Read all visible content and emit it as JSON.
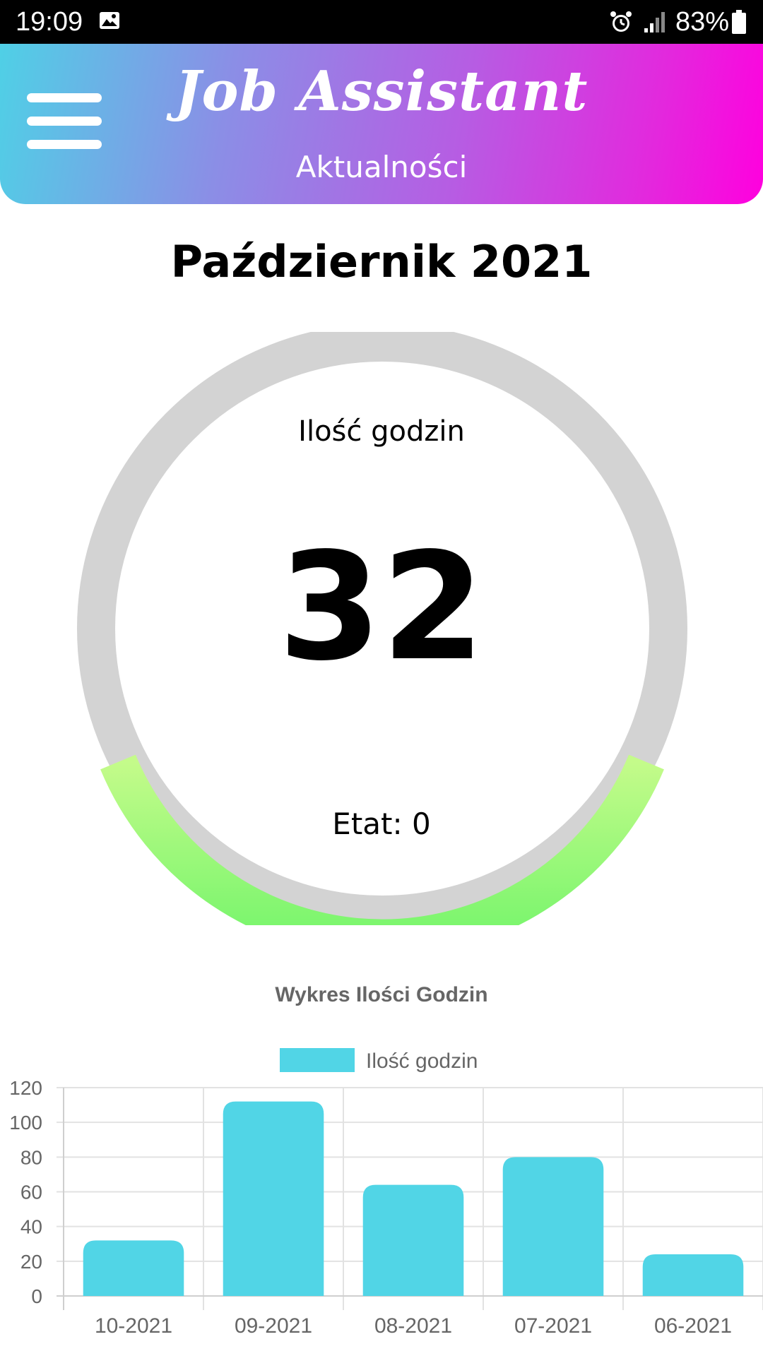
{
  "status_bar": {
    "time": "19:09",
    "battery": "83%",
    "icons": [
      "image-icon",
      "alarm-icon",
      "signal-icon",
      "battery-icon"
    ]
  },
  "header": {
    "title": "Job Assistant",
    "subtitle": "Aktualności",
    "menu_icon": "hamburger-menu-icon",
    "gradient": [
      "#4fd0e6",
      "#ff00de"
    ]
  },
  "month": {
    "title": "Październik 2021"
  },
  "gauge": {
    "label": "Ilość godzin",
    "value": "32",
    "etat_text": "Etat: 0",
    "track_color": "#d3d3d3",
    "fill_colors": [
      "#c4fb8a",
      "#77f56c"
    ]
  },
  "chart": {
    "title": "Wykres Ilości Godzin"
  },
  "chart_data": {
    "type": "bar",
    "title": "Wykres Ilości Godzin",
    "categories": [
      "10-2021",
      "09-2021",
      "08-2021",
      "07-2021",
      "06-2021"
    ],
    "series": [
      {
        "name": "Ilość godzin",
        "values": [
          32,
          112,
          64,
          80,
          24
        ],
        "color": "#51d5e6"
      }
    ],
    "yticks": [
      "0",
      "20",
      "40",
      "60",
      "80",
      "100",
      "120"
    ],
    "ylim": [
      0,
      120
    ],
    "grid": true,
    "legend": "top-center"
  }
}
